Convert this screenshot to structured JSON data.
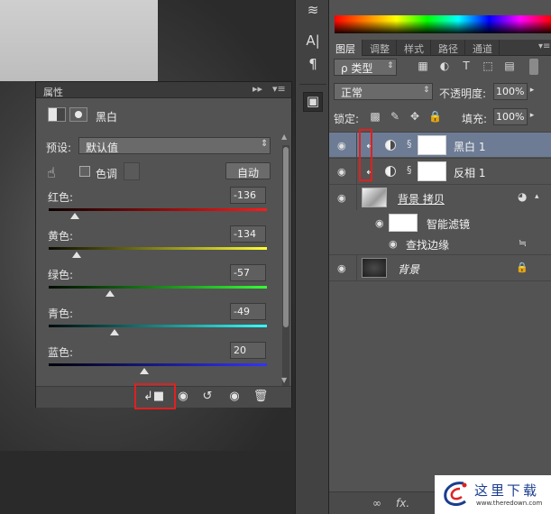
{
  "properties_panel": {
    "title": "属性",
    "collapse_glyph": "▸▸",
    "menu_glyph": "▾≡",
    "adjustment_name": "黑白",
    "preset_label": "预设:",
    "preset_value": "默认值",
    "tint_label": "色调",
    "auto_label": "自动",
    "channels": [
      {
        "label": "红色:",
        "value": "-136",
        "level_fraction": 0.12,
        "ramp": [
          "#0a0000",
          "#ff1a1a"
        ]
      },
      {
        "label": "黄色:",
        "value": "-134",
        "level_fraction": 0.13,
        "ramp": [
          "#0a0a00",
          "#ffff33"
        ]
      },
      {
        "label": "绿色:",
        "value": "-57",
        "level_fraction": 0.28,
        "ramp": [
          "#000a00",
          "#33ff33"
        ]
      },
      {
        "label": "青色:",
        "value": "-49",
        "level_fraction": 0.3,
        "ramp": [
          "#000a0a",
          "#33ffff"
        ]
      },
      {
        "label": "蓝色:",
        "value": "20",
        "level_fraction": 0.44,
        "ramp": [
          "#00000a",
          "#3333ff"
        ]
      }
    ],
    "footer_icons": [
      "clip-to-layer-icon",
      "view-previous-icon",
      "reset-icon",
      "visibility-icon",
      "trash-icon"
    ]
  },
  "tools_strip": {
    "icons": [
      "brush-preset-icon",
      "character-icon",
      "paragraph-icon",
      "properties-icon"
    ],
    "character_glyph": "A|",
    "paragraph_glyph": "¶"
  },
  "layers_panel": {
    "tabs": [
      "图层",
      "调整",
      "样式",
      "路径",
      "通道"
    ],
    "active_tab": "图层",
    "kind_filter": "ρ 类型",
    "blend_mode": "正常",
    "opacity_label": "不透明度:",
    "opacity_value": "100%",
    "lock_label": "锁定:",
    "fill_label": "填充:",
    "fill_value": "100%",
    "layers": [
      {
        "name": "黑白 1",
        "type": "adjustment",
        "selected": true,
        "clipped": true
      },
      {
        "name": "反相 1",
        "type": "adjustment",
        "selected": false,
        "clipped": true
      },
      {
        "name": "背景 拷贝",
        "type": "smart-object",
        "selected": false,
        "clipped": false
      },
      {
        "name": "智能滤镜",
        "type": "smart-filters",
        "selected": false,
        "clipped": false
      },
      {
        "name": "查找边缘",
        "type": "filter",
        "selected": false,
        "clipped": false
      },
      {
        "name": "背景",
        "type": "background",
        "selected": false,
        "clipped": false
      }
    ],
    "footer_link": "∞",
    "footer_fx": "fx."
  },
  "watermark": {
    "cn": "这里下载",
    "url": "www.theredown.com"
  },
  "colors": {
    "highlight_red": "#e02020",
    "selected_row": "#6d7c94",
    "watermark_blue": "#1b3d8f"
  }
}
